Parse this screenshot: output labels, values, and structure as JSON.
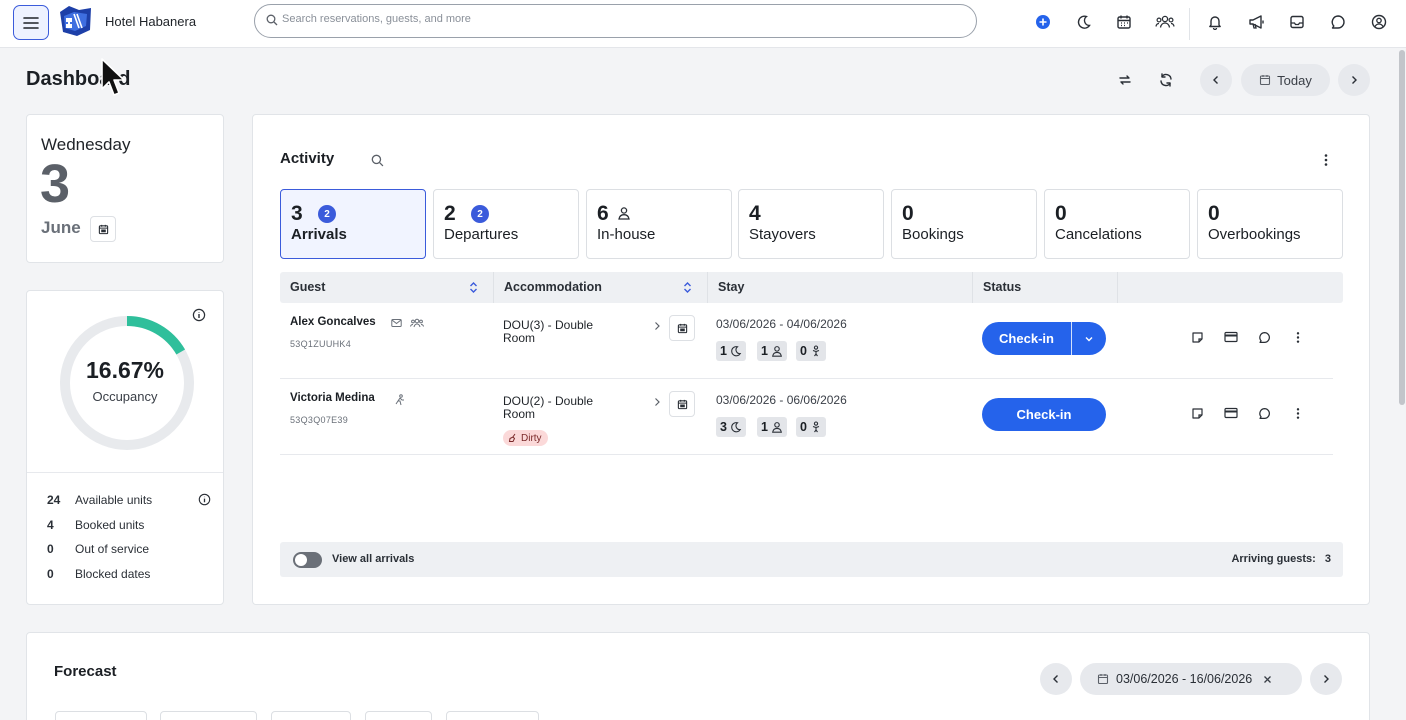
{
  "header": {
    "hotel_name": "Hotel Habanera",
    "search_placeholder": "Search reservations, guests, and more"
  },
  "page": {
    "title": "Dashboard",
    "today_label": "Today"
  },
  "date_card": {
    "weekday": "Wednesday",
    "day": "3",
    "month": "June"
  },
  "occupancy": {
    "value": "16.67%",
    "label": "Occupancy",
    "fraction": 0.1667,
    "accent_color": "#2fbf9b",
    "stats": [
      {
        "num": "24",
        "label": "Available units"
      },
      {
        "num": "4",
        "label": "Booked units"
      },
      {
        "num": "0",
        "label": "Out of service"
      },
      {
        "num": "0",
        "label": "Blocked dates"
      }
    ]
  },
  "activity": {
    "title": "Activity",
    "tabs": [
      {
        "count": "3",
        "label": "Arrivals",
        "badge": "2"
      },
      {
        "count": "2",
        "label": "Departures",
        "badge": "2"
      },
      {
        "count": "6",
        "label": "In-house"
      },
      {
        "count": "4",
        "label": "Stayovers"
      },
      {
        "count": "0",
        "label": "Bookings"
      },
      {
        "count": "0",
        "label": "Cancelations"
      },
      {
        "count": "0",
        "label": "Overbookings"
      }
    ],
    "columns": [
      "Guest",
      "Accommodation",
      "Stay",
      "Status"
    ],
    "rows": [
      {
        "guest": "Alex Goncalves",
        "code": "53Q1ZUUHK4",
        "accommodation": "DOU(3) - Double Room",
        "stay": "03/06/2026 - 04/06/2026",
        "nights": "1",
        "adults": "1",
        "children": "0",
        "status_button": "Check-in"
      },
      {
        "guest": "Victoria Medina",
        "code": "53Q3Q07E39",
        "accommodation": "DOU(2) - Double Room",
        "room_status": "Dirty",
        "stay": "03/06/2026 - 06/06/2026",
        "nights": "3",
        "adults": "1",
        "children": "0",
        "status_button": "Check-in"
      }
    ],
    "footer": {
      "toggle_label": "View all arrivals",
      "arriving_label": "Arriving guests:",
      "arriving_count": "3"
    }
  },
  "forecast": {
    "title": "Forecast",
    "date_range": "03/06/2026 - 16/06/2026"
  },
  "colors": {
    "primary": "#2563eb",
    "badge": "#3b5bdb",
    "dirty_bg": "#fbd9d9"
  }
}
